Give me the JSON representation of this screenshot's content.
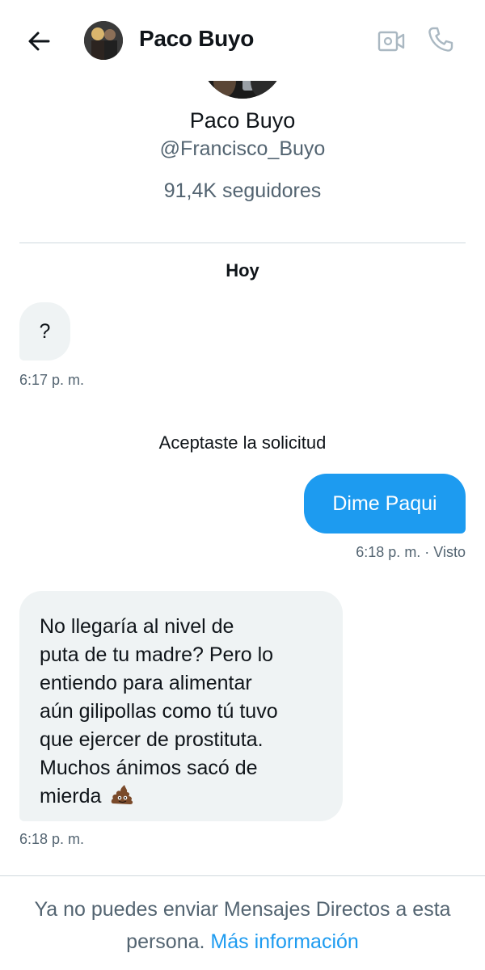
{
  "header": {
    "contact_name": "Paco Buyo"
  },
  "profile": {
    "name": "Paco Buyo",
    "handle": "@Francisco_Buyo",
    "followers": "91,4K seguidores"
  },
  "conversation": {
    "day_label": "Hoy",
    "system_message": "Aceptaste la solicitud",
    "messages": [
      {
        "direction": "incoming",
        "text": "?",
        "time": "6:17 p. m."
      },
      {
        "direction": "outgoing",
        "text": "Dime Paqui",
        "time": "6:18 p. m. · Visto"
      },
      {
        "direction": "incoming",
        "lines": [
          "No llegaría al nivel de",
          "puta de tu madre? Pero lo",
          "entiendo para alimentar",
          "aún gilipollas como tú tuvo",
          "que ejercer de prostituta.",
          "Muchos ánimos sacó de",
          "mierda"
        ],
        "emoji": "pile-of-poo",
        "time": "6:18 p. m."
      }
    ]
  },
  "footer": {
    "notice": "Ya no puedes enviar Mensajes Directos a esta persona.",
    "link": "Más información"
  },
  "colors": {
    "accent": "#1d9bf0",
    "incoming_bubble": "#eff3f4",
    "secondary_text": "#536471"
  }
}
